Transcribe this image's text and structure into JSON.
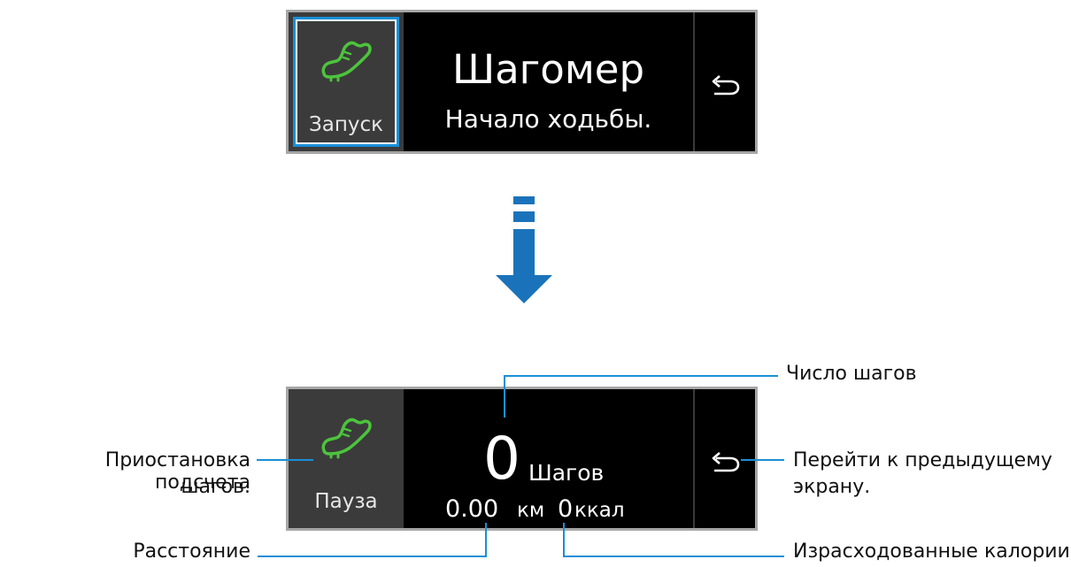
{
  "top_screen": {
    "start_label": "Запуск",
    "title": "Шагомер",
    "subtitle": "Начало ходьбы."
  },
  "bottom_screen": {
    "pause_label": "Пауза",
    "steps_value": "0",
    "steps_unit": "Шагов",
    "distance_value": "0.00",
    "distance_unit": "км",
    "calories_value": "0",
    "calories_unit": "ккал"
  },
  "annotations": {
    "pause": [
      "Приостановка подсчета",
      "шагов."
    ],
    "step_count": "Число шагов",
    "back": [
      "Перейти к предыдущему",
      "экрану."
    ],
    "distance": "Расстояние",
    "calories": "Израсходованные калории"
  },
  "icons": {
    "shoe": "shoe-icon",
    "back": "back-arrow-icon",
    "flow_arrow": "down-arrow-icon"
  },
  "colors": {
    "accent_green": "#4cc43c",
    "highlight_blue": "#1a8fd6",
    "arrow_blue": "#1a73ba"
  }
}
